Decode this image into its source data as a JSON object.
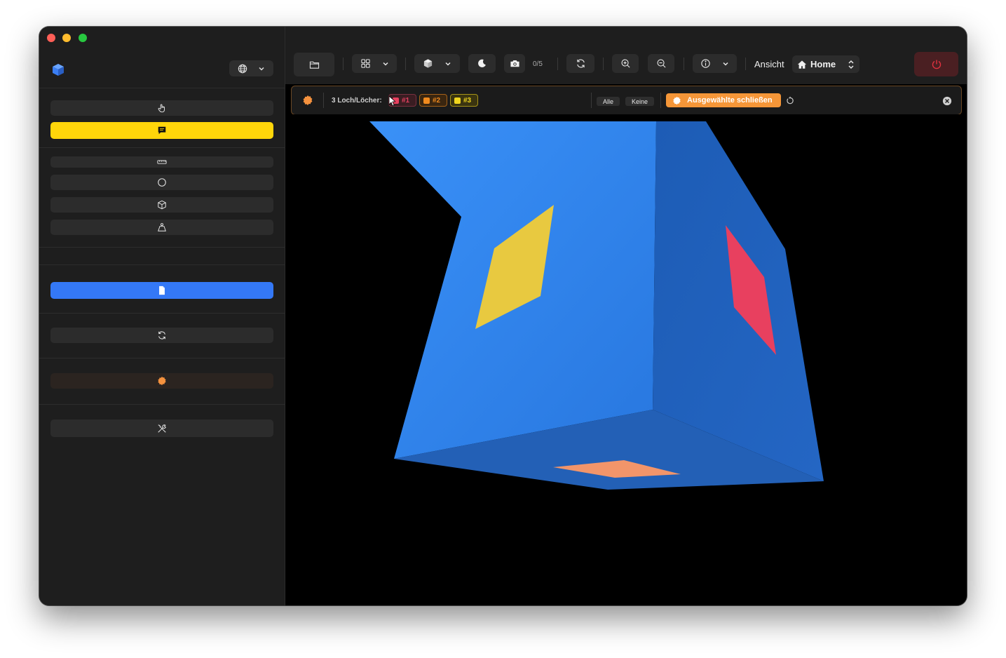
{
  "toolbar": {
    "photo_counter": "0/5",
    "view_label": "Ansicht",
    "view_select": "Home"
  },
  "holebar": {
    "count_label": "3 Loch/Löcher:",
    "holes": [
      {
        "label": "#1",
        "color": "#e8405f"
      },
      {
        "label": "#2",
        "color": "#f08a1e"
      },
      {
        "label": "#3",
        "color": "#f0d61e"
      }
    ],
    "all_label": "Alle",
    "none_label": "Keine",
    "close_selected_label": "Ausgewählte schließen"
  },
  "colors": {
    "accent_yellow": "#ffd60a",
    "accent_blue": "#3478f6",
    "accent_orange": "#f59638",
    "cube_front": "#2f86f0",
    "cube_side": "#1f5fb8"
  },
  "icons": {
    "sidebar": [
      "hand-pointer-icon",
      "comment-icon",
      "ruler-icon",
      "circle-icon",
      "cube-icon",
      "weight-icon",
      "document-icon",
      "refresh-icon",
      "gear-badge-icon",
      "tools-icon"
    ],
    "toolbar": [
      "folder-icon",
      "grid-icon",
      "cube-icon",
      "moon-icon",
      "camera-icon",
      "refresh-icon",
      "zoom-in-icon",
      "zoom-out-icon",
      "info-icon",
      "home-icon",
      "power-icon"
    ]
  }
}
